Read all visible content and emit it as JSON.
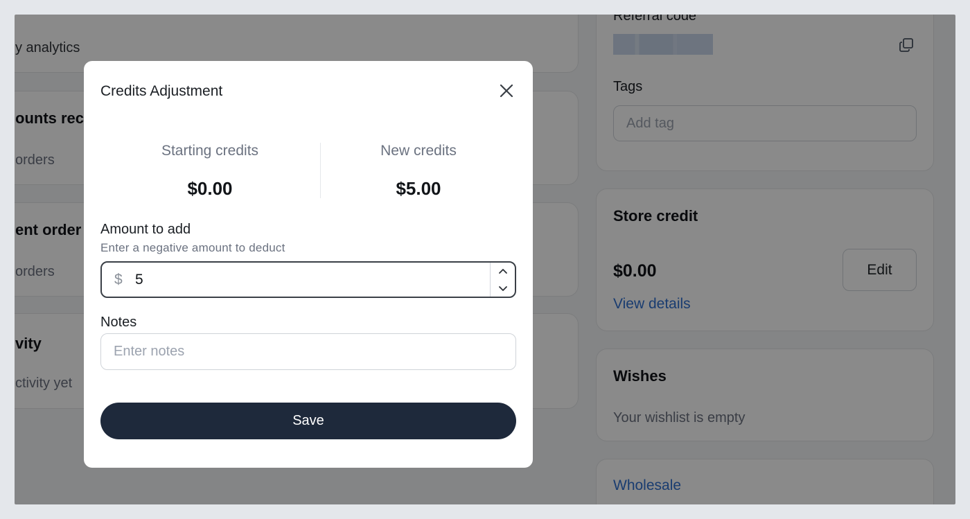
{
  "background": {
    "left_cards": [
      {
        "line1": "y analytics"
      },
      {
        "title": "ounts rec",
        "subtitle": "orders"
      },
      {
        "title": "ent order",
        "subtitle": "orders"
      },
      {
        "title": "vity",
        "subtitle": "ctivity yet"
      }
    ],
    "referral": {
      "label": "Referral code"
    },
    "tags": {
      "label": "Tags",
      "placeholder": "Add tag"
    },
    "store_credit": {
      "title": "Store credit",
      "amount": "$0.00",
      "edit_label": "Edit",
      "link": "View details"
    },
    "wishes": {
      "title": "Wishes",
      "empty_text": "Your wishlist is empty"
    },
    "wholesale": {
      "link": "Wholesale"
    }
  },
  "modal": {
    "title": "Credits Adjustment",
    "starting_label": "Starting credits",
    "starting_value": "$0.00",
    "new_label": "New credits",
    "new_value": "$5.00",
    "amount_label": "Amount to add",
    "amount_help": "Enter a negative amount to deduct",
    "currency_symbol": "$",
    "amount_value": "5",
    "notes_label": "Notes",
    "notes_placeholder": "Enter notes",
    "save_label": "Save"
  },
  "icons": {
    "close": "close-icon",
    "copy": "copy-icon",
    "chevron_up": "chevron-up-icon",
    "chevron_down": "chevron-down-icon"
  },
  "colors": {
    "save_button": "#1e293b",
    "link": "#2f6fd0",
    "overlay": "rgba(0,0,0,0.46)"
  }
}
